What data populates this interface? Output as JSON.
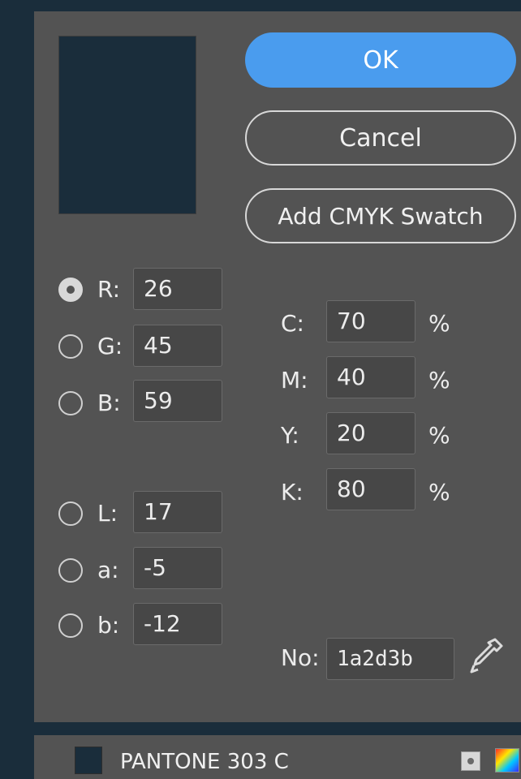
{
  "dialog": {
    "preview_color": "#1a2d3b",
    "buttons": {
      "ok": "OK",
      "cancel": "Cancel",
      "add_swatch": "Add CMYK Swatch"
    },
    "rgb": {
      "selected": "R",
      "fields": [
        {
          "label": "R:",
          "value": "26"
        },
        {
          "label": "G:",
          "value": "45"
        },
        {
          "label": "B:",
          "value": "59"
        }
      ]
    },
    "lab": {
      "fields": [
        {
          "label": "L:",
          "value": "17"
        },
        {
          "label": "a:",
          "value": "-5"
        },
        {
          "label": "b:",
          "value": "-12"
        }
      ]
    },
    "cmyk": {
      "fields": [
        {
          "label": "C:",
          "value": "70",
          "unit": "%"
        },
        {
          "label": "M:",
          "value": "40",
          "unit": "%"
        },
        {
          "label": "Y:",
          "value": "20",
          "unit": "%"
        },
        {
          "label": "K:",
          "value": "80",
          "unit": "%"
        }
      ]
    },
    "hex": {
      "label": "No:",
      "value": "1a2d3b"
    }
  },
  "swatch_bar": {
    "color": "#1a2d3b",
    "name": "PANTONE 303 C",
    "icons": [
      "spot-color-icon",
      "cmyk-mode-icon"
    ]
  },
  "colors": {
    "accent": "#4a9cee",
    "panel": "#535353",
    "background": "#1a2d3b"
  }
}
